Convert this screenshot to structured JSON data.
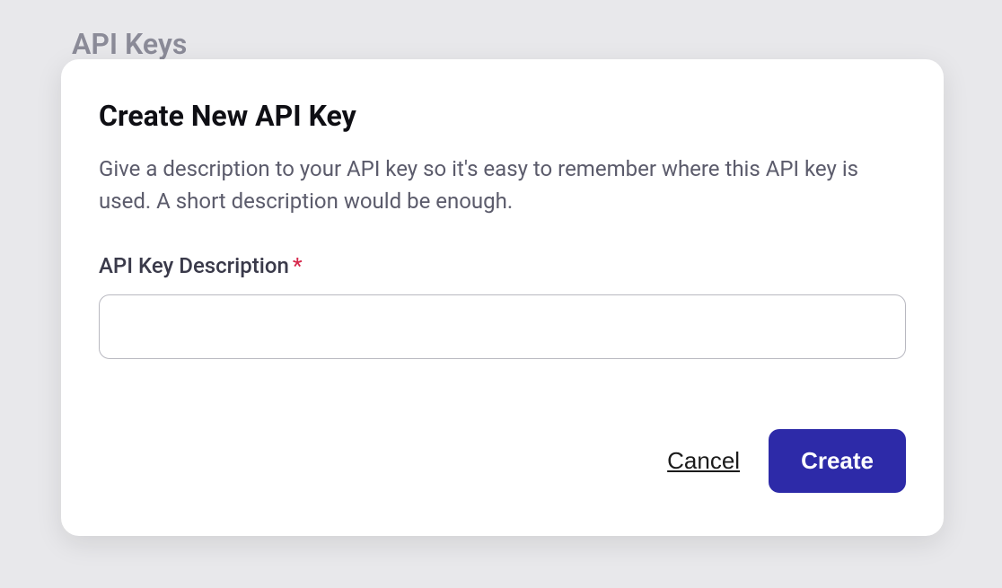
{
  "page": {
    "title": "API Keys"
  },
  "modal": {
    "title": "Create New API Key",
    "description": "Give a description to your API key so it's easy to remember where this API key is used. A short description would be enough.",
    "field": {
      "label": "API Key Description",
      "required_mark": "*",
      "value": "",
      "placeholder": ""
    },
    "actions": {
      "cancel_label": "Cancel",
      "create_label": "Create"
    }
  },
  "colors": {
    "primary": "#2d2aa8",
    "background": "#e8e8eb",
    "text_muted": "#5b5b6b",
    "required": "#d6284b"
  }
}
